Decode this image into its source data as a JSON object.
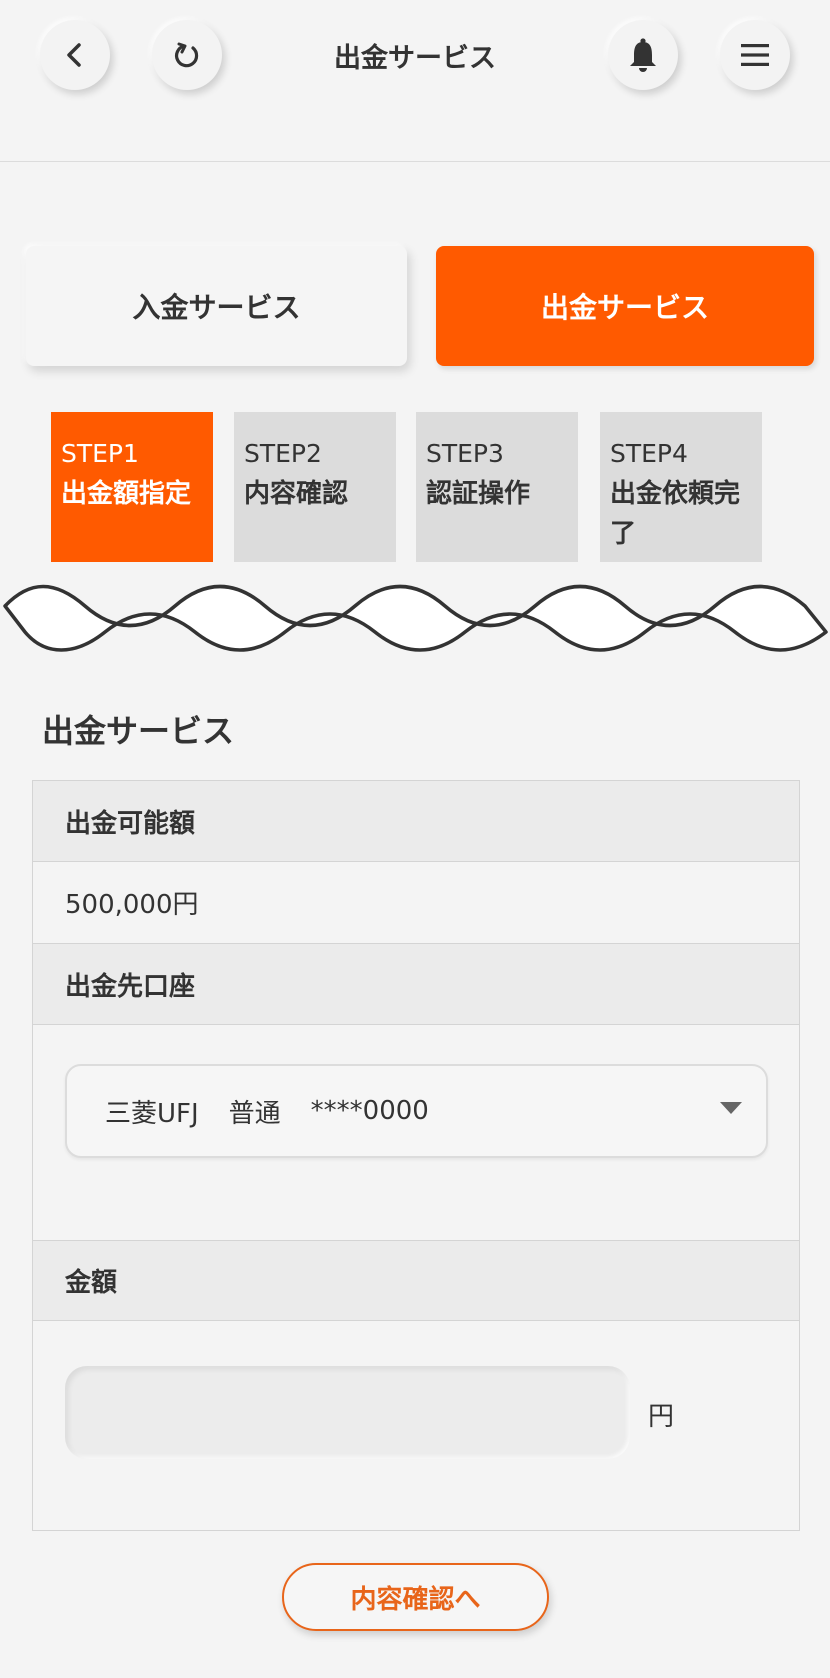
{
  "header": {
    "title": "出金サービス",
    "back_icon": "chevron-left-icon",
    "reload_icon": "refresh-icon",
    "bell_icon": "bell-icon",
    "menu_icon": "hamburger-menu-icon"
  },
  "service_tabs": {
    "deposit_label": "入金サービス",
    "withdraw_label": "出金サービス",
    "active": "withdraw",
    "accent_color": "#ff5a00"
  },
  "steps": [
    {
      "num": "STEP1",
      "label": "出金額指定",
      "active": true
    },
    {
      "num": "STEP2",
      "label": "内容確認",
      "active": false
    },
    {
      "num": "STEP3",
      "label": "認証操作",
      "active": false
    },
    {
      "num": "STEP4",
      "label": "出金依頼完了",
      "active": false
    }
  ],
  "section": {
    "title": "出金サービス"
  },
  "panel": {
    "available_label": "出金可能額",
    "available_value": "500,000円",
    "account_label": "出金先口座",
    "account_select": {
      "bank": "三菱UFJ",
      "type": "普通",
      "number": "****0000"
    },
    "amount_label": "金額",
    "amount_value": "",
    "amount_unit": "円"
  },
  "confirm_button_label": "内容確認へ"
}
